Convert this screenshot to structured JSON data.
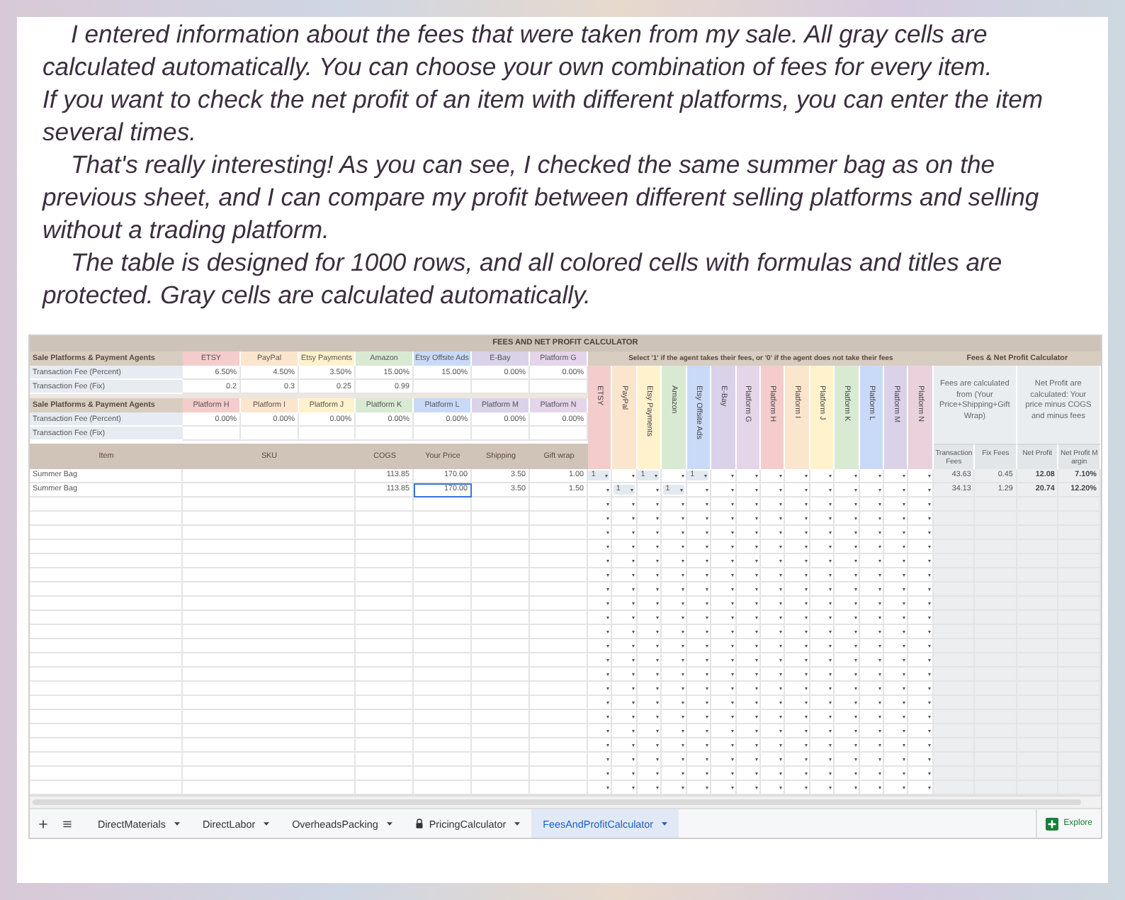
{
  "intro": [
    {
      "text": "I entered information about the fees that were taken from my sale. All gray cells are calculated automatically. You can choose your own combination of fees for every item.",
      "indent": true
    },
    {
      "text": "If you want to check the net profit of an item with different platforms, you can enter the item several times.",
      "indent": false
    },
    {
      "text": "That's really interesting! As you can see, I checked the same summer bag as on the previous sheet, and I can compare my profit between different selling platforms and selling without a trading platform.",
      "indent": true
    },
    {
      "text": "The table is designed for 1000 rows, and all colored cells with formulas and titles are protected. Gray cells are calculated automatically.",
      "indent": true
    }
  ],
  "sheet": {
    "title": "FEES AND NET PROFIT CALCULATOR",
    "fee_tables": [
      {
        "heading": "Sale Platforms & Payment Agents",
        "percent_label": "Transaction Fee (Percent)",
        "fix_label": "Transaction Fee (Fix)",
        "agents": [
          {
            "name": "ETSY",
            "color": "#f4cccc",
            "percent": "6.50%",
            "fix": "0.2"
          },
          {
            "name": "PayPal",
            "color": "#fce5cd",
            "percent": "4.50%",
            "fix": "0.3"
          },
          {
            "name": "Etsy Payments",
            "color": "#fff2cc",
            "percent": "3.50%",
            "fix": "0.25"
          },
          {
            "name": "Amazon",
            "color": "#d9ead3",
            "percent": "15.00%",
            "fix": "0.99"
          },
          {
            "name": "Etsy Offsite Ads",
            "color": "#c9daf8",
            "percent": "15.00%"
          },
          {
            "name": "E-Bay",
            "color": "#d9d2e9",
            "percent": "0.00%"
          },
          {
            "name": "Platform G",
            "color": "#e4d5ea",
            "percent": "0.00%"
          }
        ]
      },
      {
        "heading": "Sale Platforms & Payment Agents",
        "percent_label": "Transaction Fee (Percent)",
        "fix_label": "Transaction Fee (Fix)",
        "agents": [
          {
            "name": "Platform H",
            "color": "#f4cccc",
            "percent": "0.00%"
          },
          {
            "name": "Platform I",
            "color": "#fce5cd",
            "percent": "0.00%"
          },
          {
            "name": "Platform J",
            "color": "#fff2cc",
            "percent": "0.00%"
          },
          {
            "name": "Platform K",
            "color": "#d9ead3",
            "percent": "0.00%"
          },
          {
            "name": "Platform L",
            "color": "#c9daf8",
            "percent": "0.00%"
          },
          {
            "name": "Platform M",
            "color": "#d9d2e9",
            "percent": "0.00%"
          },
          {
            "name": "Platform N",
            "color": "#e4d5ea",
            "percent": "0.00%"
          }
        ]
      }
    ],
    "select_heading": "Select '1' if the agent takes their fees, or '0' if the agent does not take their fees",
    "agent_columns": [
      {
        "name": "ETSY",
        "color": "#f4cccc"
      },
      {
        "name": "PayPal",
        "color": "#fce5cd"
      },
      {
        "name": "Etsy Payments",
        "color": "#fff2cc"
      },
      {
        "name": "Amazon",
        "color": "#d9ead3"
      },
      {
        "name": "Etsy Offsite Ads",
        "color": "#c9daf8"
      },
      {
        "name": "E-Bay",
        "color": "#d9d2e9"
      },
      {
        "name": "Platform G",
        "color": "#e4d5ea"
      },
      {
        "name": "Platform H",
        "color": "#f4cccc"
      },
      {
        "name": "Platform I",
        "color": "#fce5cd"
      },
      {
        "name": "Platform J",
        "color": "#fff2cc"
      },
      {
        "name": "Platform K",
        "color": "#d9ead3"
      },
      {
        "name": "Platform L",
        "color": "#c9daf8"
      },
      {
        "name": "Platform M",
        "color": "#d9d2e9"
      },
      {
        "name": "Platform N",
        "color": "#ead1dc"
      }
    ],
    "calc_heading": "Fees & Net Profit Calculator",
    "calc_notes": [
      "Fees are calculated from (Your Price+Shipping+Gift Wrap)",
      "Net Profit are calculated: Your price minus COGS and minus fees"
    ],
    "calc_columns": [
      "Transaction Fees",
      "Fix Fees",
      "Net Profit",
      "Net Profit Margin"
    ],
    "columns": {
      "item": "Item",
      "sku": "SKU",
      "cogs": "COGS",
      "price": "Your Price",
      "shipping": "Shipping",
      "gift_wrap": "Gift wrap"
    },
    "rows": [
      {
        "item": "Summer Bag",
        "cogs": "113.85",
        "price": "170.00",
        "price_selected": false,
        "shipping": "3.50",
        "gift_wrap": "1.00",
        "agents": [
          {
            "filled": true,
            "value": "1"
          },
          {
            "filled": false
          },
          {
            "filled": true,
            "value": "1"
          },
          {
            "filled": false
          },
          {
            "filled": true,
            "value": "1"
          },
          {
            "filled": false
          },
          {
            "filled": false
          },
          {
            "filled": false
          },
          {
            "filled": false
          },
          {
            "filled": false
          },
          {
            "filled": false
          },
          {
            "filled": false
          },
          {
            "filled": false
          },
          {
            "filled": false
          }
        ],
        "calc": [
          "43.63",
          "0.45",
          "12.08",
          "7.10%"
        ]
      },
      {
        "item": "Summer Bag",
        "cogs": "113.85",
        "price": "170.00",
        "price_selected": true,
        "shipping": "3.50",
        "gift_wrap": "1.50",
        "agents": [
          {
            "filled": false
          },
          {
            "filled": true,
            "value": "1"
          },
          {
            "filled": false
          },
          {
            "filled": true,
            "value": "1"
          },
          {
            "filled": false
          },
          {
            "filled": false
          },
          {
            "filled": false
          },
          {
            "filled": false
          },
          {
            "filled": false
          },
          {
            "filled": false
          },
          {
            "filled": false
          },
          {
            "filled": false
          },
          {
            "filled": false
          },
          {
            "filled": false
          }
        ],
        "calc": [
          "34.13",
          "1.29",
          "20.74",
          "12.20%"
        ]
      }
    ]
  },
  "sheet_tabs": [
    {
      "label": "DirectMaterials",
      "selected": false,
      "locked": false
    },
    {
      "label": "DirectLabor",
      "selected": false,
      "locked": false
    },
    {
      "label": "OverheadsPacking",
      "selected": false,
      "locked": false
    },
    {
      "label": "PricingCalculator",
      "selected": false,
      "locked": true
    },
    {
      "label": "FeesAndProfitCalculator",
      "selected": true,
      "locked": false
    }
  ],
  "explore": "Explore"
}
